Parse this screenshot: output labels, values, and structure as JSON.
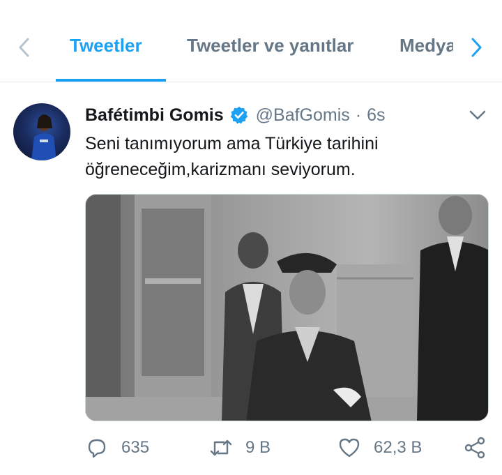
{
  "tabs": {
    "items": [
      {
        "label": "Tweetler",
        "active": true
      },
      {
        "label": "Tweetler ve yanıtlar",
        "active": false
      },
      {
        "label": "Medya",
        "active": false
      }
    ]
  },
  "tweet": {
    "author_name": "Bafétimbi Gomis",
    "verified": true,
    "handle": "@BafGomis",
    "separator": "·",
    "time": "6s",
    "text_line1": "Seni tanımıyorum ama Türkiye tarihini",
    "text_line2": "öğreneceğim,karizmanı seviyorum.",
    "media_kind": "black-and-white historical photo"
  },
  "actions": {
    "reply_count": "635",
    "retweet_count": "9 B",
    "like_count": "62,3 B"
  },
  "colors": {
    "accent": "#1da1f2",
    "muted": "#657786",
    "text": "#14171a",
    "divider": "#e6ecf0"
  },
  "icons": [
    "chevron-left-icon",
    "chevron-right-icon",
    "verified-badge-icon",
    "caret-down-icon",
    "reply-icon",
    "retweet-icon",
    "like-icon",
    "share-icon"
  ]
}
